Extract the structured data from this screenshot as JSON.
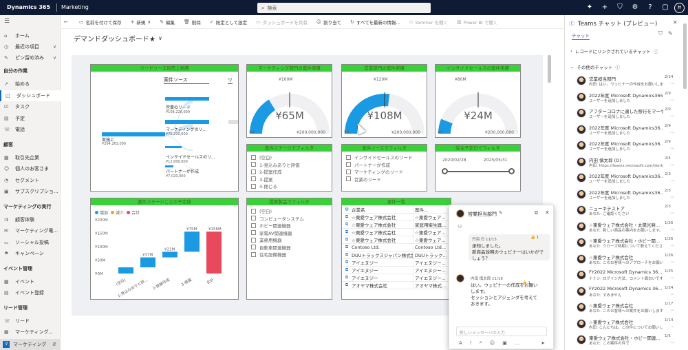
{
  "topbar": {
    "brand": "Dynamics 365",
    "app": "Marketing",
    "search_placeholder": "検索",
    "search_icon": "search-icon",
    "avatar": "井",
    "icons": [
      "lightbulb-icon",
      "plus-icon",
      "filter-icon",
      "gear-icon",
      "help-icon",
      "chat-icon"
    ]
  },
  "sidebar": {
    "top": [
      {
        "label": "ホーム",
        "icon": "⌂"
      },
      {
        "label": "最近の項目",
        "icon": "◷",
        "chev": "∨"
      },
      {
        "label": "ピン留め済み",
        "icon": "✎",
        "chev": "∨"
      }
    ],
    "sections": [
      {
        "title": "自分の作業",
        "items": [
          {
            "label": "始める",
            "icon": "↗"
          },
          {
            "label": "ダッシュボード",
            "icon": "◰",
            "active": true
          },
          {
            "label": "タスク",
            "icon": "☑"
          },
          {
            "label": "予定",
            "icon": "▤"
          },
          {
            "label": "電話",
            "icon": "☏"
          }
        ]
      },
      {
        "title": "顧客",
        "items": [
          {
            "label": "取引先企業",
            "icon": "▦"
          },
          {
            "label": "個人のお客さま",
            "icon": "☺"
          },
          {
            "label": "セグメント",
            "icon": "◔"
          },
          {
            "label": "サブスクリプショ...",
            "icon": "▣"
          }
        ]
      },
      {
        "title": "マーケティングの実行",
        "items": [
          {
            "label": "顧客体験",
            "icon": "⇉"
          },
          {
            "label": "マーケティング電...",
            "icon": "✉"
          },
          {
            "label": "ソーシャル投稿",
            "icon": "▭"
          },
          {
            "label": "キャンペーン",
            "icon": "⚑"
          }
        ]
      },
      {
        "title": "イベント管理",
        "items": [
          {
            "label": "イベント",
            "icon": "▦"
          },
          {
            "label": "イベント登録",
            "icon": "▤"
          }
        ]
      },
      {
        "title": "リード管理",
        "items": [
          {
            "label": "リード",
            "icon": "☏"
          },
          {
            "label": "マーケティング...",
            "icon": "▦"
          }
        ]
      }
    ],
    "area": "マーケティング",
    "area_letter": "マ"
  },
  "cmdbar": [
    {
      "label": "",
      "icon": "←"
    },
    {
      "label": "名前を付けて保存",
      "icon": "▭"
    },
    {
      "label": "新規",
      "icon": "+",
      "chev": "∨"
    },
    {
      "label": "編集",
      "icon": "✎"
    },
    {
      "label": "削除",
      "icon": "🗑"
    },
    {
      "label": "既定として設定",
      "icon": "✓"
    },
    {
      "label": "ダッシュボードを共有",
      "icon": "▭",
      "disabled": true
    },
    {
      "label": "割り当て",
      "icon": "☺"
    },
    {
      "label": "すべてを最新の情報...",
      "icon": "↻"
    },
    {
      "label": "Yammer を開く",
      "icon": "◇",
      "disabled": true
    },
    {
      "label": "Power BI で開く",
      "icon": "▥",
      "disabled": true
    }
  ],
  "dashboard": {
    "title": "デマンドダッシュボード★",
    "chevron": "∨"
  },
  "tiles": {
    "sankey": {
      "title": "リードソース別売上実績",
      "col_header": "案件ソース",
      "col_header2": "リ",
      "source": {
        "label": "実施上",
        "value": "¥204,263,000"
      },
      "targets": [
        {
          "label": "営業のリード",
          "value": "¥108,220,000"
        },
        {
          "label": "マーケティングのリ...",
          "value": "¥75,220,000"
        },
        {
          "label": "インサイドセールスのリ...",
          "value": "¥12,600,000"
        },
        {
          "label": "パートナーが作成",
          "value": "¥7,020,000"
        }
      ]
    },
    "g1": {
      "title": "マーケティング部門の案件実績",
      "target": "¥100M",
      "value": "¥65M",
      "min": "¥0",
      "max": "¥200,000,000",
      "fraction": 0.325
    },
    "g2": {
      "title": "営業部門の案件実績",
      "target": "¥120M",
      "value": "¥108M",
      "min": "¥0",
      "max": "¥200,000,000",
      "fraction": 0.54
    },
    "g3": {
      "title": "インサイドセールスの案件実績",
      "target": "¥80M",
      "value": "¥24M",
      "min": "¥0",
      "max": "¥200,000,000",
      "fraction": 0.12
    },
    "f_stage": {
      "title": "案件ステージでフィルタ",
      "items": [
        "(空白)",
        "1-見込みありと評価",
        "2-提案作成",
        "3-提案",
        "4-閉じる"
      ]
    },
    "f_source": {
      "title": "案件ソースでフィルタ",
      "items": [
        "インサイドセールスのリード",
        "パートナーが作成",
        "マーケティングのリード",
        "営業のリード"
      ]
    },
    "f_date": {
      "title": "受注予定日でフィルタ",
      "from": "2020/02/28",
      "to": "2025/05/31"
    },
    "waterfall": {
      "title": "案件ステージごとの予定値",
      "legend": [
        {
          "label": "増加",
          "color": "#1b9ae4"
        },
        {
          "label": "減少",
          "color": "#f0a030"
        },
        {
          "label": "合計",
          "color": "#e8495c"
        }
      ],
      "yticks": [
        "¥200M",
        "¥150M",
        "¥100M",
        "¥50M",
        "¥0M"
      ],
      "categories": [
        "(空白)",
        "1-見込みありと評...",
        "2-提案作成",
        "3-提案",
        "合計"
      ],
      "labels": [
        "",
        "¥37M",
        "¥21M",
        "¥75M",
        "¥156M"
      ],
      "chart_data": {
        "type": "bar",
        "categories": [
          "(空白)",
          "1-見込みありと評...",
          "2-提案作成",
          "3-提案",
          "合計"
        ],
        "values": [
          23,
          37,
          21,
          75,
          156
        ],
        "ylim": [
          0,
          200
        ]
      }
    },
    "f_product": {
      "title": "提案製品でフィルタ",
      "items": [
        "(空白)",
        "コンピュータシステム",
        "ホビー関連機器",
        "家電AV関連機器",
        "業務用機器",
        "自動車関連機器",
        "住宅設備機器"
      ]
    },
    "table": {
      "title": "案件一覧",
      "col1": "企業名",
      "col2": "案件...",
      "rows": [
        [
          "☆東愛ウェア株式会社",
          "☆東愛ウェア..."
        ],
        [
          "☆東愛ウェア株式会社",
          "家庭用衛生器..."
        ],
        [
          "☆東愛ウェア株式会社",
          "☆東愛ウェア..."
        ],
        [
          "☆東愛ウェア株式会社",
          "☆東愛ウェア..."
        ],
        [
          "Contoso Ltd.",
          "Contoso Ltd..."
        ],
        [
          "DUUトラックスジャパン株式会社",
          "DUUトラック..."
        ],
        [
          "アイエヌジー",
          "アイエヌジー..."
        ],
        [
          "アイエヌジー",
          "アイエヌジー..."
        ],
        [
          "アイエヌジー",
          "アイエヌジー..."
        ],
        [
          "アオヤマ株式会社",
          "アオヤマ株式..."
        ]
      ]
    }
  },
  "chat_popup": {
    "title": "営業担当部門",
    "msg1_meta": "丹羽 日 11/15",
    "msg1": "承知しました。\n新商品説明のウェビナーはいかがでしょう？",
    "msg2_meta": "内田 慎太郎 11/16",
    "msg2": "はい。ウェビナーの作成をお願いします。\nセッションとアジェンダを考えておきます。",
    "input_placeholder": "新しいメッセージの入力",
    "reaction": "👍 1"
  },
  "teams": {
    "title": "Teams チャット (プレビュー)",
    "tab": "チャット",
    "linked": "レコードにリンクされているチャット",
    "other": "その他のチャット",
    "items": [
      {
        "name": "営業担当部門",
        "preview": "内田: はい。ウェビナーの作成をお願いします。",
        "date": "2/14"
      },
      {
        "name": "2022年度 Microsoft Dynamics365...",
        "preview": "ユーザーを追加しました",
        "date": "2/9"
      },
      {
        "name": "アフターコロナに適した移行をマーケテ...",
        "preview": "ユーザーを追加しました",
        "date": "2/9"
      },
      {
        "name": "2022年度 Microsoft Dynamics36...",
        "preview": "ユーザーを追加しました",
        "date": "2/9"
      },
      {
        "name": "2022年度 Microsoft Dynamics36...",
        "preview": "ユーザーを追加しました",
        "date": "2/9"
      },
      {
        "name": "内田 慎太郎 (O)",
        "preview": "内田: https://teams.microsoft.com/l/enty...",
        "date": "2/4"
      },
      {
        "name": "2022年度 Microsoft Dynamics36...",
        "preview": "ユーザーを追加しました",
        "date": "2/3"
      },
      {
        "name": "2022年度 Microsoft Dynamics36...",
        "preview": "ユーザーを追加しました",
        "date": "2/3"
      },
      {
        "name": "ニューネテストア",
        "preview": "あなた: ご確認ください",
        "date": "2/3"
      },
      {
        "name": "☆東愛ウェア株式会社・太陽光発...",
        "preview": "あなた: 新しい商品の案内をお願いします。",
        "date": "1/26"
      },
      {
        "name": "☆東愛ウェア株式会社・ホビー関...",
        "preview": "あなた: クローズ時期について教えてください",
        "date": "1/26"
      },
      {
        "name": "☆東愛ウェア株式会社",
        "preview": "あなた: このお客様へのアプローチをお願いします",
        "date": "1/26"
      },
      {
        "name": "FY2022 Microsoft Dynamics 36...",
        "preview": "ナナシ: ログイン方法、コメント面白いです",
        "date": "1/25"
      },
      {
        "name": "FY2022 Microsoft Dynamics 36...",
        "preview": "あなた: すみません",
        "date": "1/24"
      },
      {
        "name": "☆東愛ウェア株式会社",
        "preview": "あなた: このお客様への案件をお願いします",
        "date": "1/17"
      },
      {
        "name": "☆東愛ウェア株式会社",
        "preview": "内田: こんにちは。この件についてお願いします",
        "date": "1/14"
      },
      {
        "name": "東愛ウェア株式会社・ホビー関連...",
        "preview": "あなた: この案件の件で",
        "date": "1/5"
      }
    ]
  }
}
